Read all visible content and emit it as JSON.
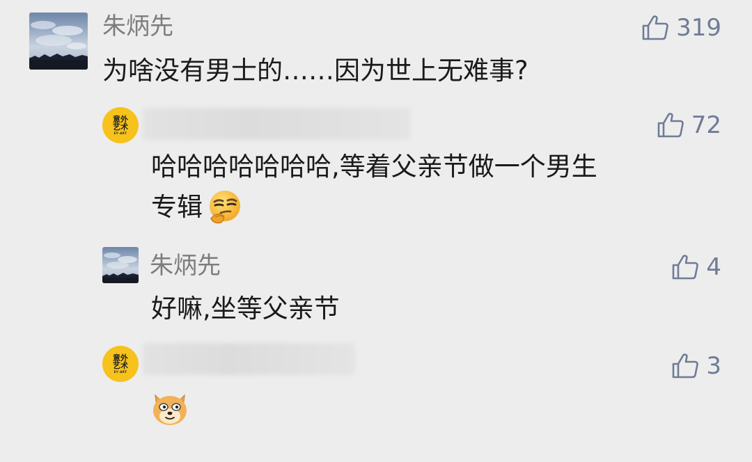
{
  "comments": [
    {
      "username": "朱炳先",
      "text": "为啥没有男士的……因为世上无难事?",
      "likes": "319"
    }
  ],
  "replies": [
    {
      "username": "",
      "avatar_logo": [
        "意外",
        "艺术",
        "EY·ART"
      ],
      "text_line1": "哈哈哈哈哈哈哈,等着父亲节做一个男生",
      "text_line2": "专辑",
      "emoji": "smirk-emoji",
      "likes": "72"
    },
    {
      "username": "朱炳先",
      "text": "好嘛,坐等父亲节",
      "likes": "4"
    },
    {
      "username": "",
      "avatar_logo": [
        "意外",
        "艺术",
        "EY·ART"
      ],
      "emoji": "doge-emoji",
      "likes": "3"
    }
  ],
  "colors": {
    "background": "#ededed",
    "username": "#7d7d7d",
    "like": "#6f7c96",
    "logo_avatar": "#f6c21b"
  }
}
